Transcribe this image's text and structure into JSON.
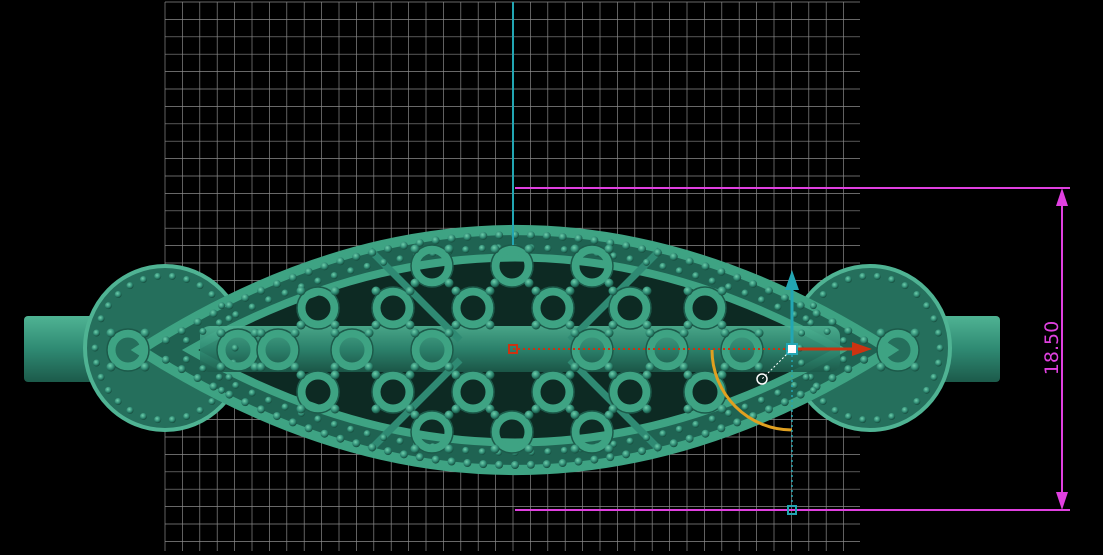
{
  "viewport": {
    "background": "#000000",
    "grid_color": "#8a8a8a",
    "model_color": "#2f8a73",
    "model_dark": "#1c5a4a",
    "model_light": "#4fb393"
  },
  "dimension": {
    "label": "18.50",
    "color": "#e040e0"
  },
  "gizmo": {
    "x_axis_color": "#cc3311",
    "y_axis_color": "#22a6b3",
    "rotate_arc_color": "#e0a020",
    "icons": [
      "move-x-arrow",
      "move-y-arrow",
      "rotate-arc-handle",
      "center-handle"
    ]
  }
}
